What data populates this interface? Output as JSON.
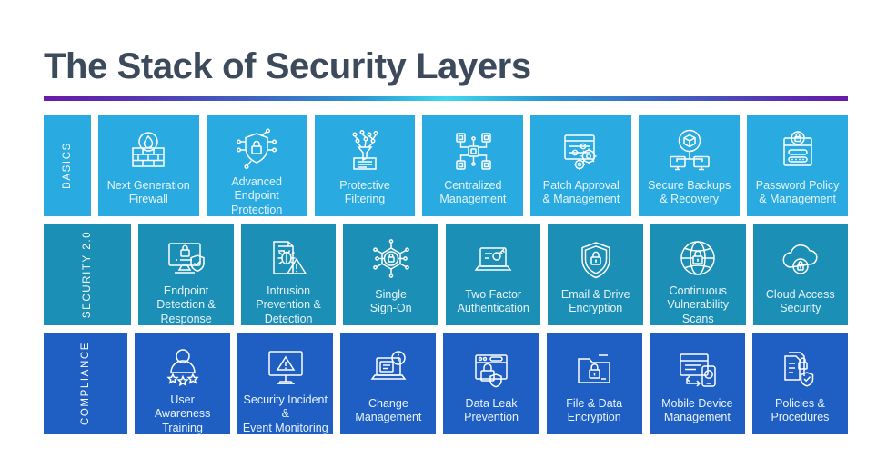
{
  "header": {
    "title": "The Stack of Security Layers"
  },
  "colors": {
    "title_text": "#3d4a5c",
    "rule_start": "#6a1ba8",
    "rule_middle": "#3fd8ef",
    "rule_end": "#6a1ba8",
    "row_basics": "#29abe2",
    "row_security": "#1b8fb5",
    "row_compliance": "#1f5fc4",
    "tile_text": "#e8f4fb"
  },
  "rows": [
    {
      "label": "BASICS",
      "color": "#29abe2",
      "tiles": [
        {
          "label": "Next Generation\nFirewall",
          "icon": "firewall-flame-icon"
        },
        {
          "label": "Advanced\nEndpoint\nProtection",
          "icon": "shield-lock-nodes-icon"
        },
        {
          "label": "Protective\nFiltering",
          "icon": "filter-funnel-nodes-icon"
        },
        {
          "label": "Centralized\nManagement",
          "icon": "network-nodes-icon"
        },
        {
          "label": "Patch Approval\n& Management",
          "icon": "settings-sliders-gears-icon"
        },
        {
          "label": "Secure Backups\n& Recovery",
          "icon": "cloud-box-monitors-icon"
        },
        {
          "label": "Password Policy\n& Management",
          "icon": "password-form-lock-icon"
        }
      ]
    },
    {
      "label": "SECURITY 2.0",
      "color": "#1b8fb5",
      "tiles": [
        {
          "label": "Endpoint\nDetection &\nResponse",
          "icon": "monitor-lock-shield-icon"
        },
        {
          "label": "Intrusion\nPrevention &\nDetection",
          "icon": "document-bug-warning-icon"
        },
        {
          "label": "Single\nSign-On",
          "icon": "circuit-lock-icon"
        },
        {
          "label": "Two Factor\nAuthentication",
          "icon": "laptop-key-icon"
        },
        {
          "label": "Email & Drive\nEncryption",
          "icon": "shield-padlock-icon"
        },
        {
          "label": "Continuous\nVulnerability\nScans",
          "icon": "globe-lock-icon"
        },
        {
          "label": "Cloud Access\nSecurity",
          "icon": "cloud-lock-icon"
        }
      ]
    },
    {
      "label": "COMPLIANCE",
      "color": "#1f5fc4",
      "tiles": [
        {
          "label": "User\nAwareness\nTraining",
          "icon": "user-stars-icon"
        },
        {
          "label": "Security Incident &\nEvent Monitoring",
          "icon": "monitor-warning-icon"
        },
        {
          "label": "Change\nManagement",
          "icon": "laptop-info-icon"
        },
        {
          "label": "Data Leak\nPrevention",
          "icon": "browser-lock-shield-icon"
        },
        {
          "label": "File & Data\nEncryption",
          "icon": "folder-lock-icon"
        },
        {
          "label": "Mobile Device\nManagement",
          "icon": "monitor-phone-sync-icon"
        },
        {
          "label": "Policies &\nProcedures",
          "icon": "documents-lock-check-icon"
        }
      ]
    }
  ]
}
